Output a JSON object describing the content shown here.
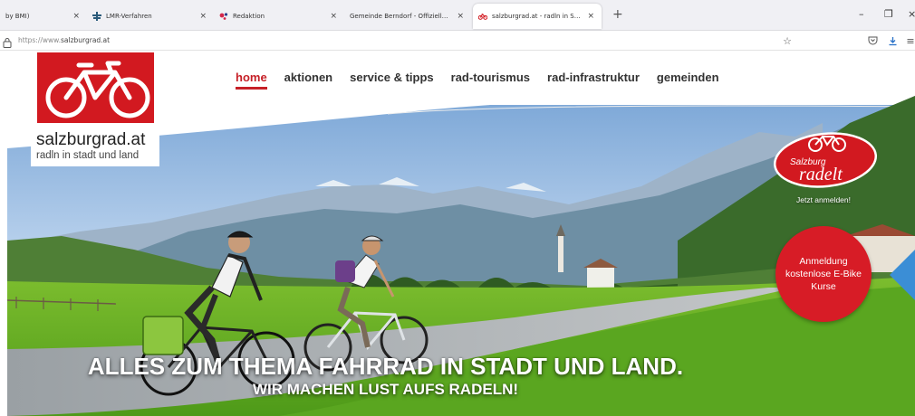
{
  "browser": {
    "tabs": [
      {
        "title": "by BMI)",
        "icon": "generic-tab-icon",
        "active": false
      },
      {
        "title": "LMR-Verfahren",
        "icon": "lmr-favicon-icon",
        "active": false
      },
      {
        "title": "Redaktion",
        "icon": "redaktion-favicon-icon",
        "active": false
      },
      {
        "title": "Gemeinde Berndorf - Offizielle Hom",
        "icon": "none",
        "active": false
      },
      {
        "title": "salzburgrad.at - radln in Stadt u",
        "icon": "bike-favicon-icon",
        "active": true
      }
    ],
    "new_tab": "+",
    "close": "×",
    "window_controls": {
      "minimize": "–",
      "restore": "❐",
      "close": "×"
    },
    "url": {
      "protocol": "https://www.",
      "host": "salzburgrad.at"
    }
  },
  "site": {
    "logo": {
      "name": "salzburgrad.at",
      "tagline": "radln in stadt und land"
    },
    "nav": [
      {
        "label": "home",
        "active": true
      },
      {
        "label": "aktionen",
        "active": false
      },
      {
        "label": "service & tipps",
        "active": false
      },
      {
        "label": "rad-tourismus",
        "active": false
      },
      {
        "label": "rad-infrastruktur",
        "active": false
      },
      {
        "label": "gemeinden",
        "active": false
      }
    ],
    "badge": {
      "line1": "Salzburg",
      "line2": "radelt",
      "cta": "Jetzt anmelden!"
    },
    "registration": {
      "text": "Anmeldung\nkostenlose E-Bike\nKurse"
    },
    "headline": {
      "line1": "ALLES ZUM THEMA FAHRRAD IN STADT UND LAND.",
      "line2": "WIR MACHEN LUST AUFS RADELN!"
    }
  },
  "colors": {
    "brand_red": "#d21920",
    "nav_active": "#c62027",
    "circle_red": "#d71c26"
  }
}
